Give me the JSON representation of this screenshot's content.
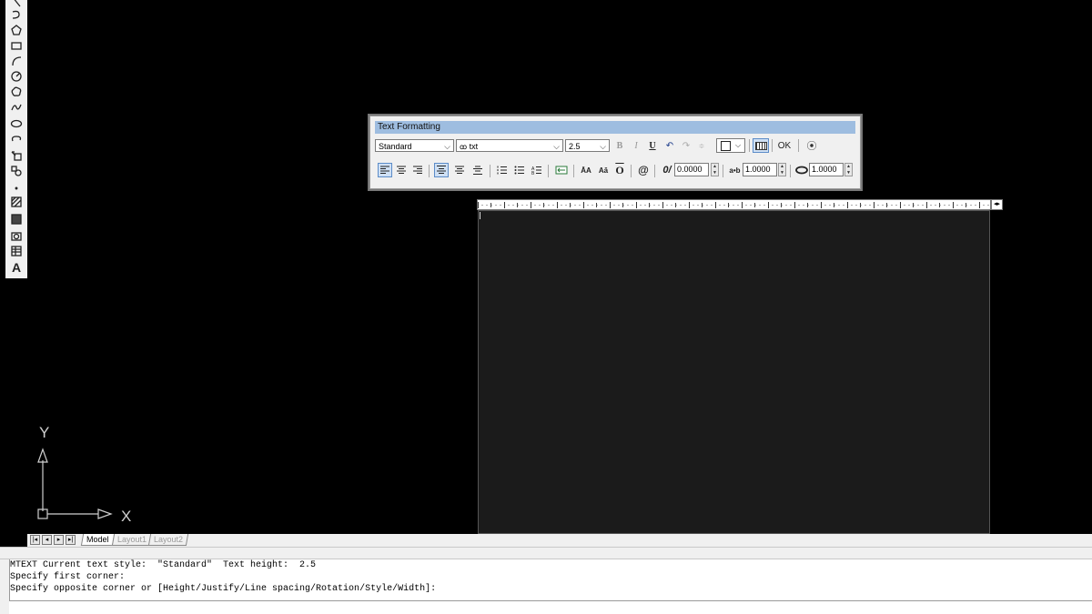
{
  "draw_toolbar": {
    "tools": [
      {
        "icon": "xline-icon"
      },
      {
        "icon": "polyline-icon"
      },
      {
        "icon": "polygon-icon"
      },
      {
        "icon": "rectangle-icon"
      },
      {
        "icon": "arc-icon"
      },
      {
        "icon": "circle-icon"
      },
      {
        "icon": "revcloud-icon"
      },
      {
        "icon": "spline-icon"
      },
      {
        "icon": "ellipse-icon"
      },
      {
        "icon": "ellipse-arc-icon"
      },
      {
        "icon": "insert-block-icon"
      },
      {
        "icon": "make-block-icon"
      },
      {
        "icon": "point-icon"
      },
      {
        "icon": "hatch-icon"
      },
      {
        "icon": "gradient-icon"
      },
      {
        "icon": "region-icon"
      },
      {
        "icon": "table-icon"
      },
      {
        "icon": "multiline-text-icon",
        "label": "A"
      }
    ]
  },
  "ucs": {
    "y_label": "Y",
    "x_label": "X"
  },
  "text_formatting": {
    "title": "Text Formatting",
    "style_value": "Standard",
    "font_value": "txt",
    "height_value": "2.5",
    "ok_label": "OK",
    "oblique_value": "0.0000",
    "tracking_value": "1.0000",
    "width_factor_value": "1.0000",
    "bold_label": "B",
    "italic_label": "I",
    "underline_label": "U",
    "uppercase_label": "ĀA",
    "lowercase_label": "Aā",
    "at_label": "@",
    "oblique_label": "0/",
    "tracking_label": "a•b"
  },
  "layout_tabs": {
    "tabs": [
      "Model",
      "Layout1",
      "Layout2"
    ],
    "active": "Model"
  },
  "command_history": [
    "MTEXT Current text style:  \"Standard\"  Text height:  2.5",
    "Specify first corner:",
    "Specify opposite corner or [Height/Justify/Line spacing/Rotation/Style/Width]:"
  ],
  "colors": {
    "canvas": "#000000",
    "title_bar": "#9ebde0",
    "mtext_area": "#1b1b1b"
  }
}
